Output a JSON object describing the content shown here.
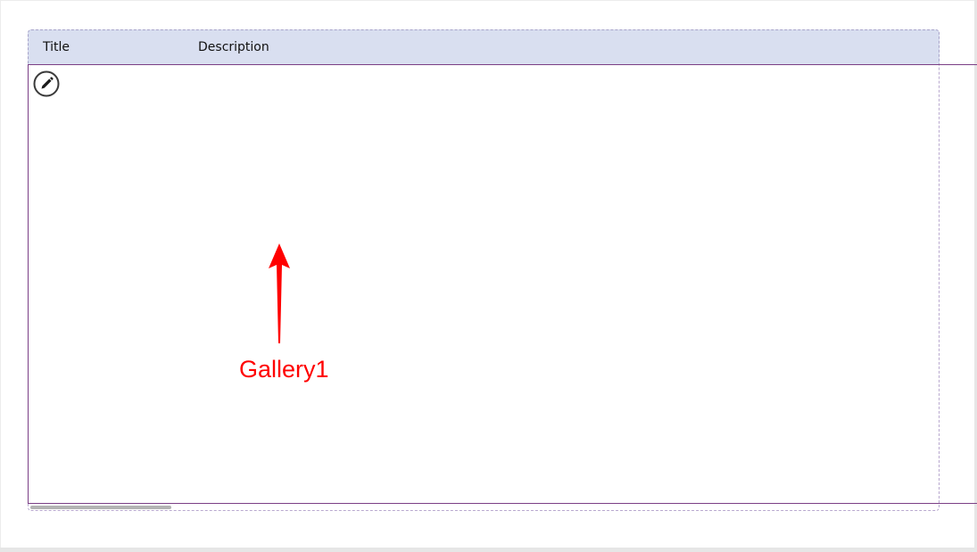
{
  "table": {
    "columns": [
      "Title",
      "Description"
    ]
  },
  "gallery": {
    "edit_icon": "pencil-edit-icon"
  },
  "annotation": {
    "label": "Gallery1"
  },
  "colors": {
    "header_bg": "#d9dff0",
    "gallery_border": "#7b3f86",
    "annotation": "#ff0000",
    "scrollbar": "#b3b3b3"
  }
}
